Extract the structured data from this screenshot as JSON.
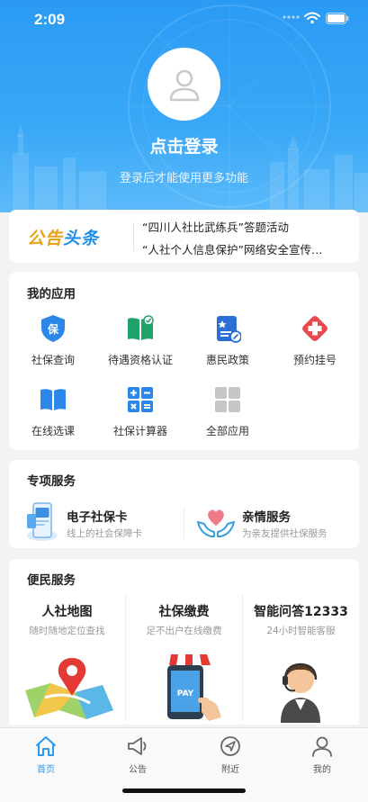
{
  "status_bar": {
    "time": "2:09"
  },
  "header": {
    "login_title": "点击登录",
    "login_subtitle": "登录后才能使用更多功能"
  },
  "notice": {
    "logo_part1": "公告",
    "logo_part2": "头条",
    "items": [
      "“四川人社比武练兵”答题活动",
      "“人社个人信息保护”网络安全宣传…"
    ]
  },
  "my_apps": {
    "title": "我的应用",
    "items": [
      {
        "label": "社保查询",
        "icon": "shield-icon"
      },
      {
        "label": "待遇资格认证",
        "icon": "book-check-icon"
      },
      {
        "label": "惠民政策",
        "icon": "policy-doc-icon"
      },
      {
        "label": "预约挂号",
        "icon": "medical-cross-icon"
      },
      {
        "label": "在线选课",
        "icon": "open-book-icon"
      },
      {
        "label": "社保计算器",
        "icon": "calculator-icon"
      },
      {
        "label": "全部应用",
        "icon": "grid-icon"
      }
    ]
  },
  "special_services": {
    "title": "专项服务",
    "items": [
      {
        "name": "电子社保卡",
        "desc": "线上的社会保障卡",
        "icon": "phone-card-icon"
      },
      {
        "name": "亲情服务",
        "desc": "为亲友提供社保服务",
        "icon": "hands-heart-icon"
      }
    ]
  },
  "convenience": {
    "title": "便民服务",
    "items": [
      {
        "title": "人社地图",
        "desc": "随时随地定位查找",
        "icon": "map-pin-illustration"
      },
      {
        "title": "社保缴费",
        "desc": "足不出户在线缴费",
        "icon": "pay-phone-illustration",
        "pay_text": "PAY"
      },
      {
        "title": "智能问答12333",
        "desc": "24小时智能客服",
        "icon": "customer-service-illustration"
      }
    ]
  },
  "tabbar": {
    "tabs": [
      {
        "label": "首页",
        "icon": "home-icon",
        "active": true
      },
      {
        "label": "公告",
        "icon": "megaphone-icon",
        "active": false
      },
      {
        "label": "附近",
        "icon": "navigation-icon",
        "active": false
      },
      {
        "label": "我的",
        "icon": "person-icon",
        "active": false
      }
    ]
  },
  "colors": {
    "primary": "#2b9af3",
    "notice_orange": "#e9a319",
    "alert_red": "#e8484f"
  }
}
